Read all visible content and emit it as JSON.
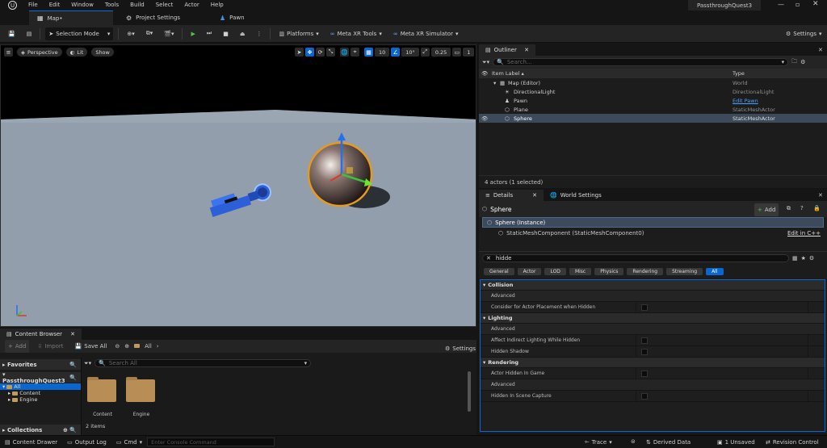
{
  "menu": {
    "items": [
      "File",
      "Edit",
      "Window",
      "Tools",
      "Build",
      "Select",
      "Actor",
      "Help"
    ]
  },
  "project_name": "PassthroughQuest3",
  "tabs": [
    {
      "label": "Map•"
    },
    {
      "label": "Project Settings"
    },
    {
      "label": "Pawn"
    }
  ],
  "toolbar": {
    "selection_mode": "Selection Mode",
    "platforms": "Platforms",
    "meta_xr_tools": "Meta XR Tools",
    "meta_xr_simulator": "Meta XR Simulator",
    "settings": "Settings"
  },
  "viewport": {
    "perspective": "Perspective",
    "lit": "Lit",
    "show": "Show",
    "grid_snap": "10",
    "rotate_snap": "10°",
    "scale_snap": "0.25",
    "camera_speed": "1"
  },
  "content_browser": {
    "tab": "Content Browser",
    "add": "Add",
    "import": "Import",
    "save_all": "Save All",
    "path": "All",
    "settings": "Settings",
    "favorites": "Favorites",
    "project": "PassthroughQuest3",
    "tree": [
      "All",
      "Content",
      "Engine"
    ],
    "collections": "Collections",
    "search_placeholder": "Search All",
    "folders": [
      "Content",
      "Engine"
    ],
    "item_count": "2 items"
  },
  "statusbar": {
    "content_drawer": "Content Drawer",
    "output_log": "Output Log",
    "cmd": "Cmd",
    "console_placeholder": "Enter Console Command",
    "trace": "Trace",
    "derived_data": "Derived Data",
    "unsaved": "1 Unsaved",
    "revision_control": "Revision Control"
  },
  "outliner": {
    "tab": "Outliner",
    "search_placeholder": "Search...",
    "col_label": "Item Label ▴",
    "col_type": "Type",
    "rows": [
      {
        "label": "Map (Editor)",
        "type": "World"
      },
      {
        "label": "DirectionalLight",
        "type": "DirectionalLight"
      },
      {
        "label": "Pawn",
        "type": "Edit Pawn"
      },
      {
        "label": "Plane",
        "type": "StaticMeshActor"
      },
      {
        "label": "Sphere",
        "type": "StaticMeshActor"
      }
    ],
    "footer": "4 actors (1 selected)"
  },
  "details": {
    "tab": "Details",
    "world_settings_tab": "World Settings",
    "actor_name": "Sphere",
    "add": "Add",
    "instance": "Sphere (Instance)",
    "component": "StaticMeshComponent (StaticMeshComponent0)",
    "edit_in_cpp": "Edit in C++",
    "search_value": "hidde",
    "filters": [
      "General",
      "Actor",
      "LOD",
      "Misc",
      "Physics",
      "Rendering",
      "Streaming",
      "All"
    ],
    "categories": [
      {
        "name": "Collision",
        "advanced": "Advanced",
        "props": [
          "Consider for Actor Placement when Hidden"
        ]
      },
      {
        "name": "Lighting",
        "advanced": "Advanced",
        "props": [
          "Affect Indirect Lighting While Hidden",
          "Hidden Shadow"
        ]
      },
      {
        "name": "Rendering",
        "advanced": "Advanced",
        "props": [
          "Actor Hidden In Game",
          "Hidden In Scene Capture"
        ]
      }
    ]
  },
  "colors": {
    "accent": "#0a67d0",
    "selected_row": "#3c4a5c",
    "link": "#4aa3ff"
  }
}
